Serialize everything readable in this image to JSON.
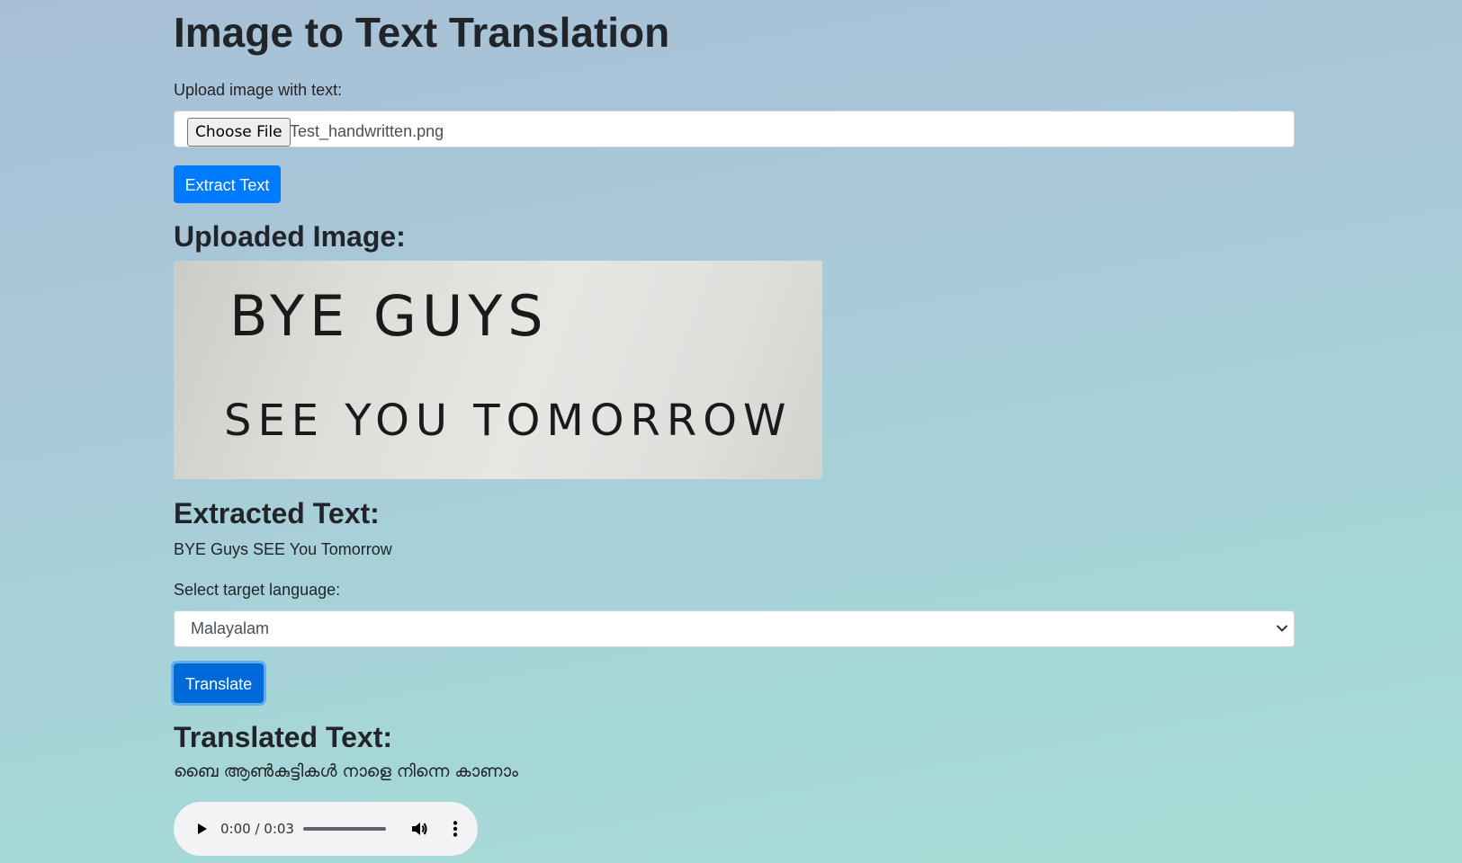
{
  "page": {
    "title": "Image to Text Translation"
  },
  "upload": {
    "label": "Upload image with text:",
    "choose_button": "Choose File",
    "file_name": "Test_handwritten.png",
    "extract_button": "Extract Text"
  },
  "uploaded_image": {
    "heading": "Uploaded Image:",
    "handwritten_lines": [
      "BYE GUYS",
      "SEE YOU TOMORROW"
    ]
  },
  "extracted": {
    "heading": "Extracted Text:",
    "text": "BYE Guys SEE You Tomorrow"
  },
  "language": {
    "label": "Select target language:",
    "selected": "Malayalam"
  },
  "translate": {
    "button": "Translate"
  },
  "translated": {
    "heading": "Translated Text:",
    "text": "ബൈ ആൺകുട്ടികൾ നാളെ നിന്നെ കാണാം"
  },
  "audio": {
    "time": "0:00 / 0:03",
    "progress": 0
  },
  "icons": {
    "play": "play-icon",
    "volume": "volume-icon",
    "more": "more-vert-icon",
    "dropdown": "chevron-down-icon"
  },
  "colors": {
    "primary": "#007bff",
    "primary_focused": "#0069d9",
    "text": "#212529"
  }
}
